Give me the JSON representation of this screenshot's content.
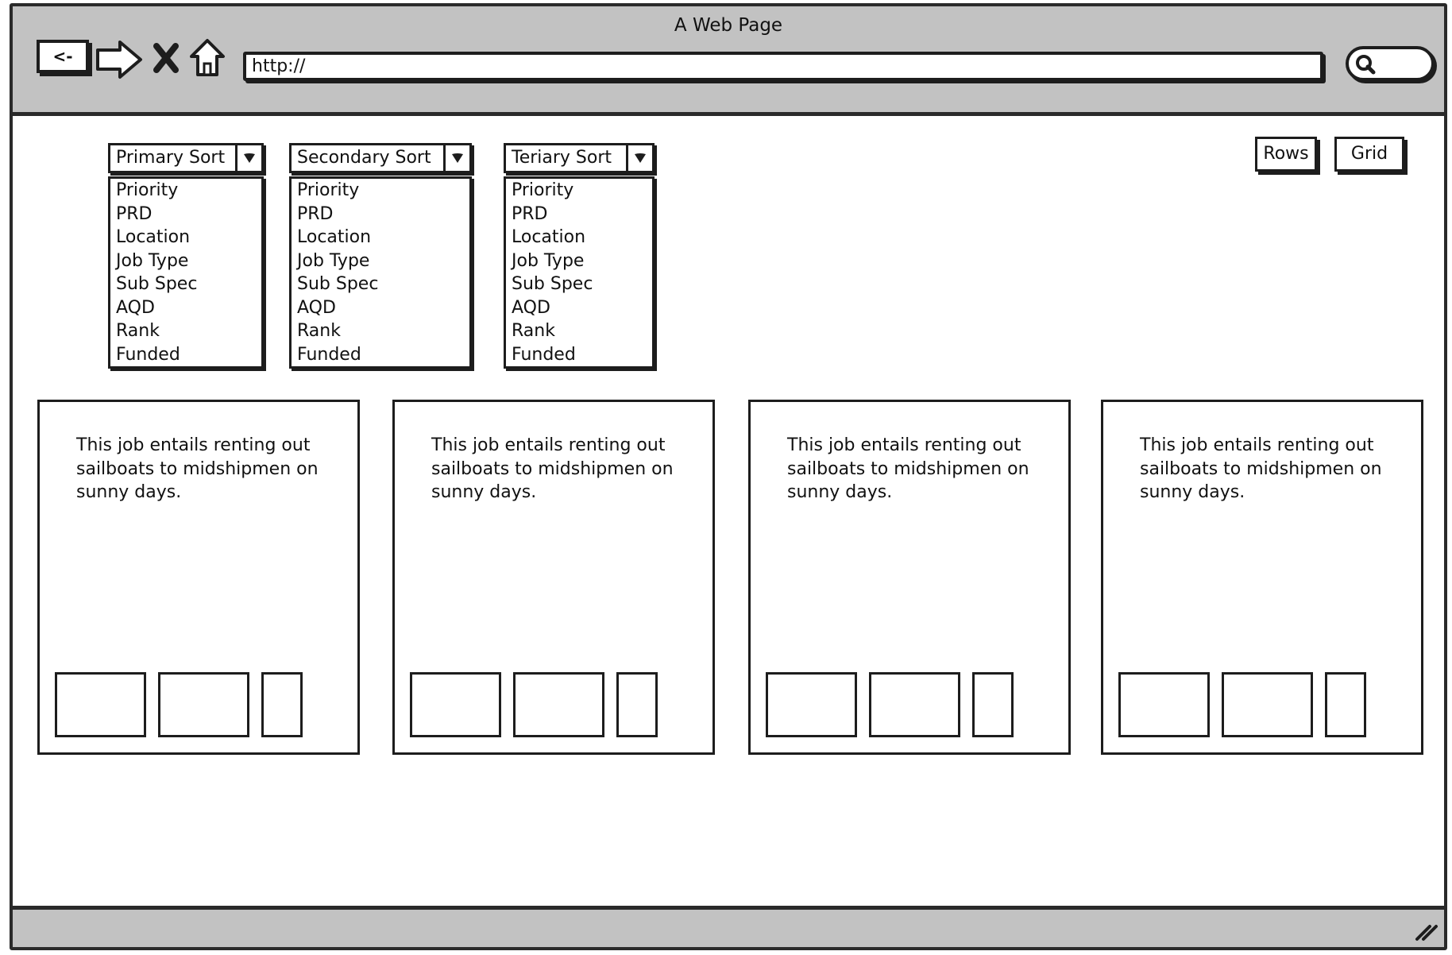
{
  "window": {
    "title": "A Web Page"
  },
  "nav": {
    "back_label": "<-"
  },
  "address_bar": {
    "value": "http://"
  },
  "sort_controls": [
    {
      "label": "Primary Sort",
      "options": [
        "Priority",
        "PRD",
        "Location",
        "Job Type",
        "Sub Spec",
        "AQD",
        "Rank",
        "Funded"
      ]
    },
    {
      "label": "Secondary Sort",
      "options": [
        "Priority",
        "PRD",
        "Location",
        "Job Type",
        "Sub Spec",
        "AQD",
        "Rank",
        "Funded"
      ]
    },
    {
      "label": "Teriary Sort",
      "options": [
        "Priority",
        "PRD",
        "Location",
        "Job Type",
        "Sub Spec",
        "AQD",
        "Rank",
        "Funded"
      ]
    }
  ],
  "view_toggle": {
    "rows_label": "Rows",
    "grid_label": "Grid"
  },
  "cards": [
    {
      "description": "This job entails renting out sailboats to midshipmen on sunny days."
    },
    {
      "description": "This job entails renting out sailboats to midshipmen on sunny days."
    },
    {
      "description": "This job entails renting out sailboats to midshipmen on sunny days."
    },
    {
      "description": "This job entails renting out sailboats to midshipmen on sunny days."
    }
  ],
  "icons": {
    "back": "back-arrow-icon",
    "forward": "forward-arrow-icon",
    "stop": "close-icon",
    "home": "home-icon",
    "search": "search-icon",
    "dropdown": "chevron-down-icon",
    "resize": "resize-grip-icon"
  }
}
